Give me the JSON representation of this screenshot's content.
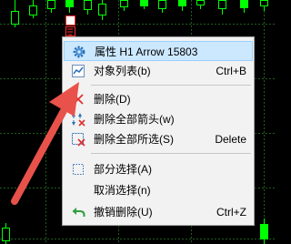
{
  "context_menu": {
    "items": [
      {
        "label": "属性 H1 Arrow 15803",
        "shortcut": "",
        "icon": "gear-icon"
      },
      {
        "label": "对象列表(b)",
        "shortcut": "Ctrl+B",
        "icon": "chart-icon"
      },
      {
        "label": "删除(D)",
        "shortcut": "",
        "icon": "red-x-icon"
      },
      {
        "label": "删除全部箭头(w)",
        "shortcut": "",
        "icon": "arrows-icon"
      },
      {
        "label": "删除全部所选(S)",
        "shortcut": "Delete",
        "icon": "delete-selection-icon"
      },
      {
        "label": "部分选择(A)",
        "shortcut": "",
        "icon": "dotted-square-icon"
      },
      {
        "label": "取消选择(n)",
        "shortcut": "",
        "icon": ""
      },
      {
        "label": "撤销删除(U)",
        "shortcut": "Ctrl+Z",
        "icon": "undo-arrow-icon"
      }
    ]
  },
  "colors": {
    "chart_background": "#000000",
    "grid": "#1f5f1f",
    "candle_outline": "#00ff00",
    "arrow_annotation": "#e8524a",
    "arrow_marker": "#ff3030",
    "menu_background": "#f2f2f2",
    "menu_highlight": "#cce8ff"
  }
}
